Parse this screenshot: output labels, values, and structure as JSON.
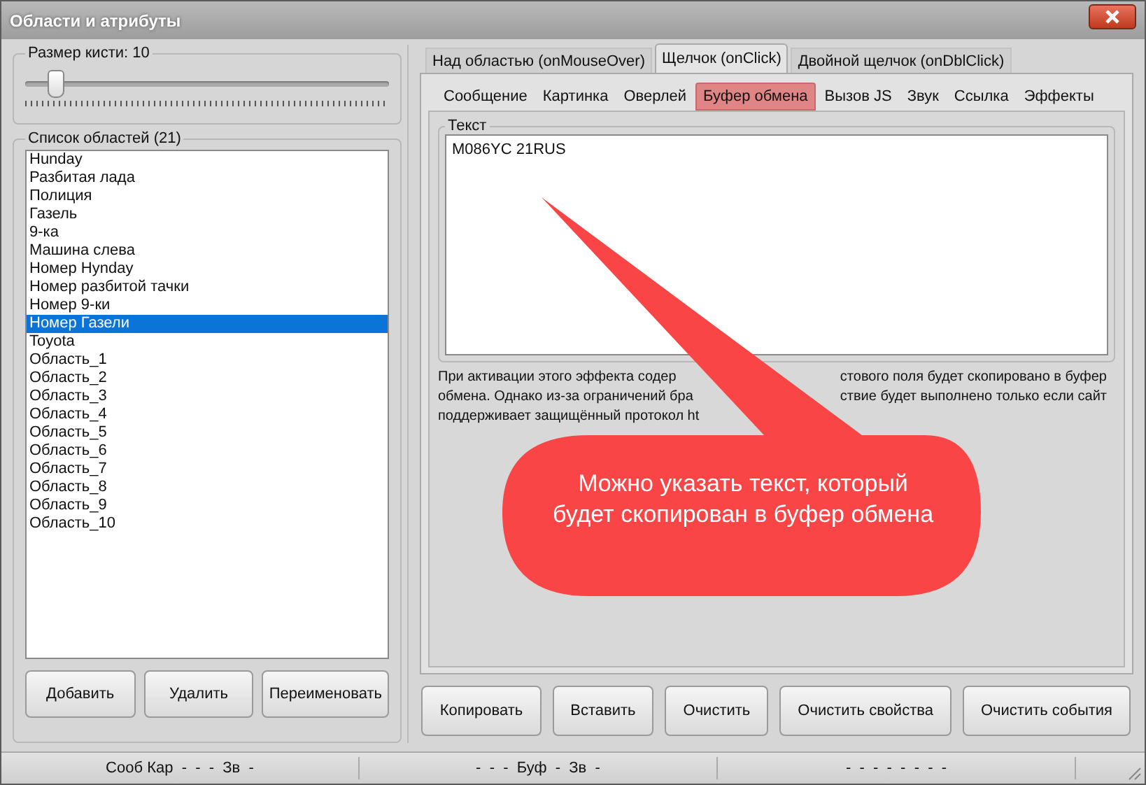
{
  "window": {
    "title": "Области и атрибуты"
  },
  "brush": {
    "label": "Размер кисти: 10",
    "level": 0.08
  },
  "areas": {
    "label": "Список областей (21)",
    "items": [
      {
        "name": "Hunday",
        "selected": false
      },
      {
        "name": "Разбитая лада",
        "selected": false
      },
      {
        "name": "Полиция",
        "selected": false
      },
      {
        "name": "Газель",
        "selected": false
      },
      {
        "name": "9-ка",
        "selected": false
      },
      {
        "name": "Машина слева",
        "selected": false
      },
      {
        "name": "Номер Hynday",
        "selected": false
      },
      {
        "name": "Номер разбитой тачки",
        "selected": false
      },
      {
        "name": "Номер 9-ки",
        "selected": false
      },
      {
        "name": "Номер Газели",
        "selected": true
      },
      {
        "name": "Toyota",
        "selected": false
      },
      {
        "name": "Область_1",
        "selected": false
      },
      {
        "name": "Область_2",
        "selected": false
      },
      {
        "name": "Область_3",
        "selected": false
      },
      {
        "name": "Область_4",
        "selected": false
      },
      {
        "name": "Область_5",
        "selected": false
      },
      {
        "name": "Область_6",
        "selected": false
      },
      {
        "name": "Область_7",
        "selected": false
      },
      {
        "name": "Область_8",
        "selected": false
      },
      {
        "name": "Область_9",
        "selected": false
      },
      {
        "name": "Область_10",
        "selected": false
      }
    ],
    "buttons": [
      "Добавить",
      "Удалить",
      "Переименовать"
    ]
  },
  "event_tabs": [
    {
      "label": "Над областью (onMouseOver)",
      "selected": false
    },
    {
      "label": "Щелчок (onClick)",
      "selected": true
    },
    {
      "label": "Двойной щелчок (onDblClick)",
      "selected": false
    }
  ],
  "effect_tabs": [
    {
      "label": "Сообщение",
      "selected": false
    },
    {
      "label": "Картинка",
      "selected": false
    },
    {
      "label": "Оверлей",
      "selected": false
    },
    {
      "label": "Буфер обмена",
      "selected": true
    },
    {
      "label": "Вызов JS",
      "selected": false
    },
    {
      "label": "Звук",
      "selected": false
    },
    {
      "label": "Ссылка",
      "selected": false
    },
    {
      "label": "Эффекты",
      "selected": false
    }
  ],
  "text_group": {
    "label": "Текст",
    "value": "M086YC 21RUS"
  },
  "description_lines": [
    {
      "left": "При активации этого эффекта содер",
      "right": "стового поля будет скопировано в буфер"
    },
    {
      "left": "обмена. Однако из-за ограничений бра",
      "right": "ствие будет выполнено только если сайт"
    },
    {
      "left": "поддерживает защищённый протокол ht"
    }
  ],
  "callout": {
    "text": "Можно указать текст, который будет скопирован в буфер обмена"
  },
  "action_buttons": [
    "Копировать",
    "Вставить",
    "Очистить",
    "Очистить свойства",
    "Очистить события"
  ],
  "status_bar": [
    "Сооб Кар  -  -  -  Зв  -",
    "-  -  -  Буф  -  Зв  -",
    "-  -  -  -  -  -  -  -"
  ]
}
